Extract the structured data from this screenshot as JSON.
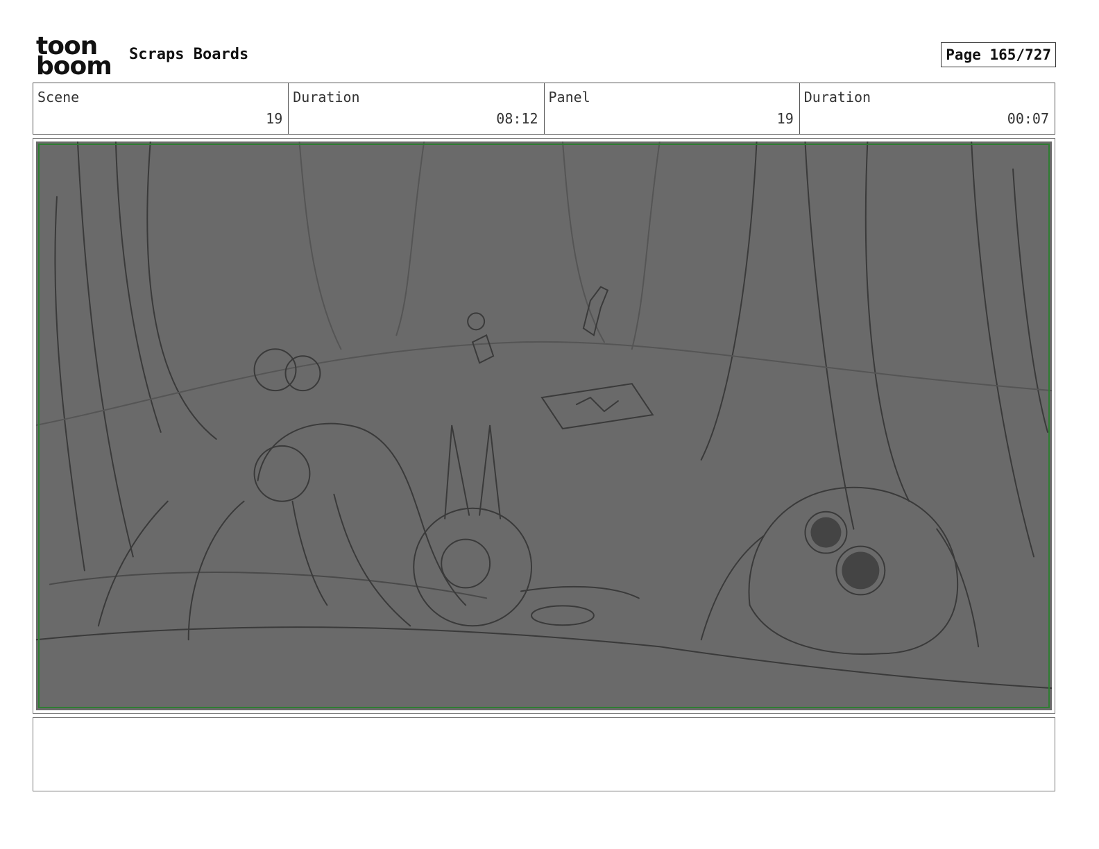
{
  "header": {
    "logo_line1": "toon",
    "logo_line2": "boom",
    "title": "Scraps Boards",
    "page_label": "Page 165/727"
  },
  "info": [
    {
      "label": "Scene",
      "value": "19"
    },
    {
      "label": "Duration",
      "value": "08:12"
    },
    {
      "label": "Panel",
      "value": "19"
    },
    {
      "label": "Duration",
      "value": "00:07"
    }
  ],
  "panel": {
    "background_color": "#6a6a6a",
    "safe_frame_color": "#2e7d32"
  },
  "notes": {
    "text": ""
  }
}
